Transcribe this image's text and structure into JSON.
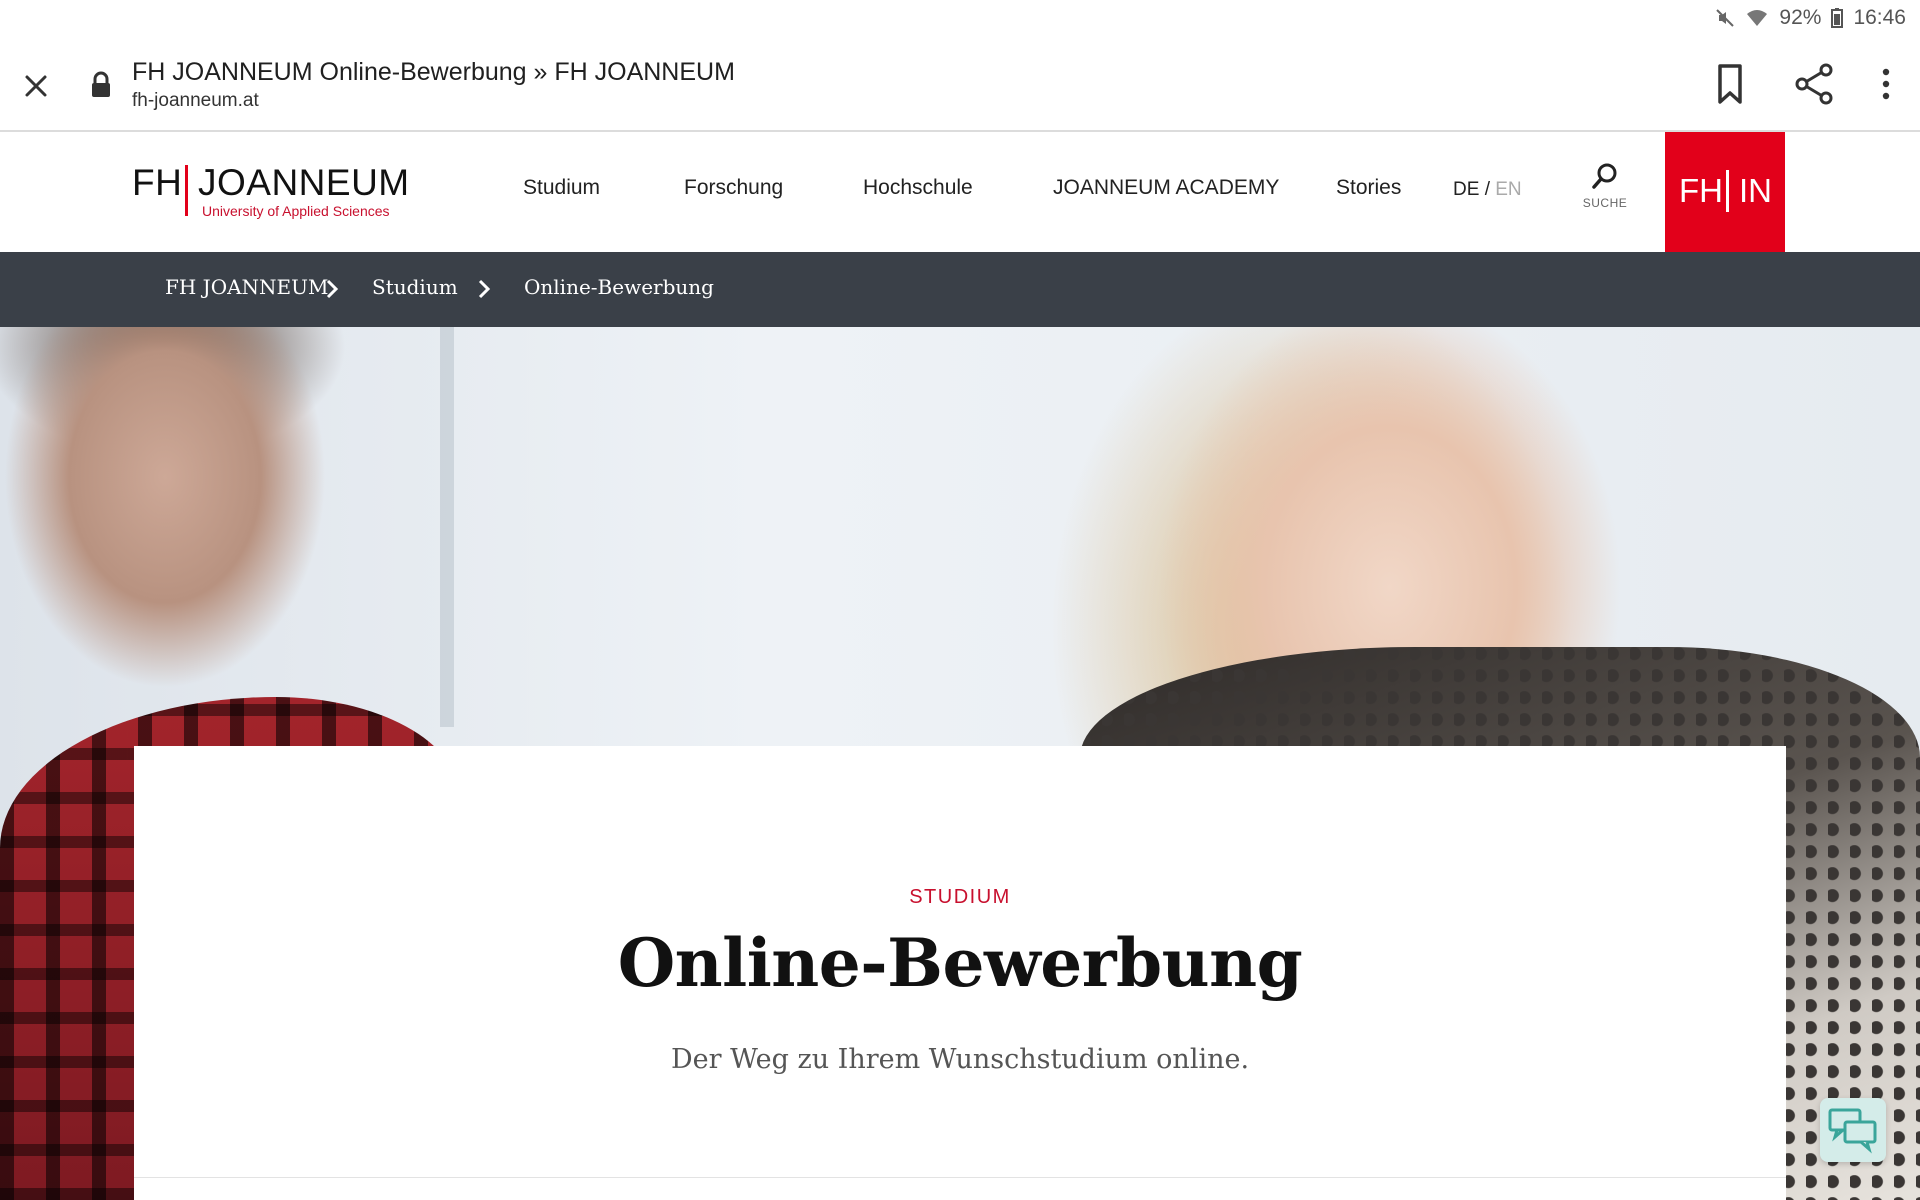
{
  "status_bar": {
    "battery": "92%",
    "time": "16:46",
    "icons": [
      "mute-icon",
      "wifi-icon",
      "battery-icon"
    ]
  },
  "browser": {
    "page_title": "FH JOANNEUM Online-Bewerbung » FH JOANNEUM",
    "url": "fh-joanneum.at",
    "icons": [
      "close-icon",
      "lock-icon",
      "bookmark-icon",
      "share-icon",
      "more-vert-icon"
    ]
  },
  "site_header": {
    "logo": {
      "main_left": "FH",
      "main_right": "JOANNEUM",
      "subtitle": "University of Applied Sciences"
    },
    "nav": [
      {
        "label": "Studium"
      },
      {
        "label": "Forschung"
      },
      {
        "label": "Hochschule"
      },
      {
        "label": "JOANNEUM ACADEMY"
      },
      {
        "label": "Stories"
      }
    ],
    "lang": {
      "de": "DE",
      "separator": "/",
      "en": "EN"
    },
    "search_label": "SUCHE",
    "fhin": {
      "left": "FH",
      "right": "IN"
    }
  },
  "breadcrumb": [
    {
      "label": "FH JOANNEUM"
    },
    {
      "label": "Studium"
    },
    {
      "label": "Online-Bewerbung"
    }
  ],
  "hero_card": {
    "kicker": "STUDIUM",
    "title": "Online-Bewerbung",
    "subtitle": "Der Weg zu Ihrem Wunschstudium online."
  },
  "colors": {
    "brand_red": "#e2001a",
    "breadcrumb_bg": "#3a4048",
    "chat_bg": "#d4ece9"
  }
}
